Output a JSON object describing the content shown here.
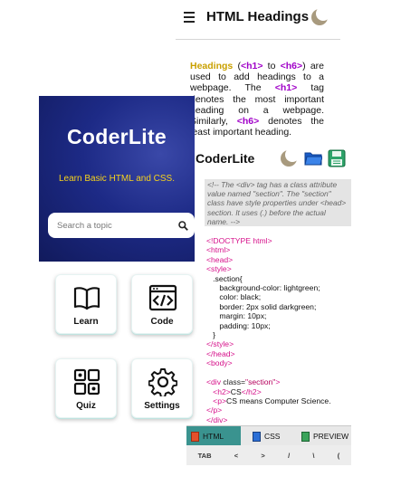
{
  "article": {
    "title": "HTML Headings",
    "intro_keyword": "Headings",
    "intro_rest_1": " (",
    "tag_h1": "<h1>",
    "to_word": " to ",
    "tag_h6": "<h6>",
    "intro_rest_2": ") are used to add headings to a webpage. The ",
    "intro_rest_3": " tag denotes the most important heading on a webpage. Similarly, ",
    "intro_rest_4": " denotes the least important heading."
  },
  "editor": {
    "title": "CoderLite",
    "comment": "<!-- The <div> tag has a class attribute value named \"section\". The \"section\" class have style properties under <head> section. It uses (.) before the actual name. -->",
    "tabs": [
      "HTML",
      "CSS",
      "PREVIEW"
    ],
    "keys": [
      "TAB",
      "<",
      ">",
      "/",
      "\\",
      "("
    ]
  },
  "home": {
    "brand": "CoderLite",
    "tagline": "Learn Basic HTML and CSS.",
    "search_placeholder": "Search a topic",
    "tiles": {
      "learn": "Learn",
      "code": "Code",
      "quiz": "Quiz",
      "settings": "Settings"
    }
  },
  "icons": {
    "menu": "hamburger-icon",
    "theme": "moon-icon",
    "open": "folder-icon",
    "save": "floppy-icon",
    "search": "search-icon",
    "learn": "book-icon",
    "code": "code-window-icon",
    "quiz": "grid-icon",
    "settings": "gear-icon"
  },
  "colors": {
    "hero": "#1d2a86",
    "tagline": "#f6d21c",
    "keyword": "#c9a000",
    "tag": "#a000c8",
    "active_tab": "#3a938f"
  }
}
